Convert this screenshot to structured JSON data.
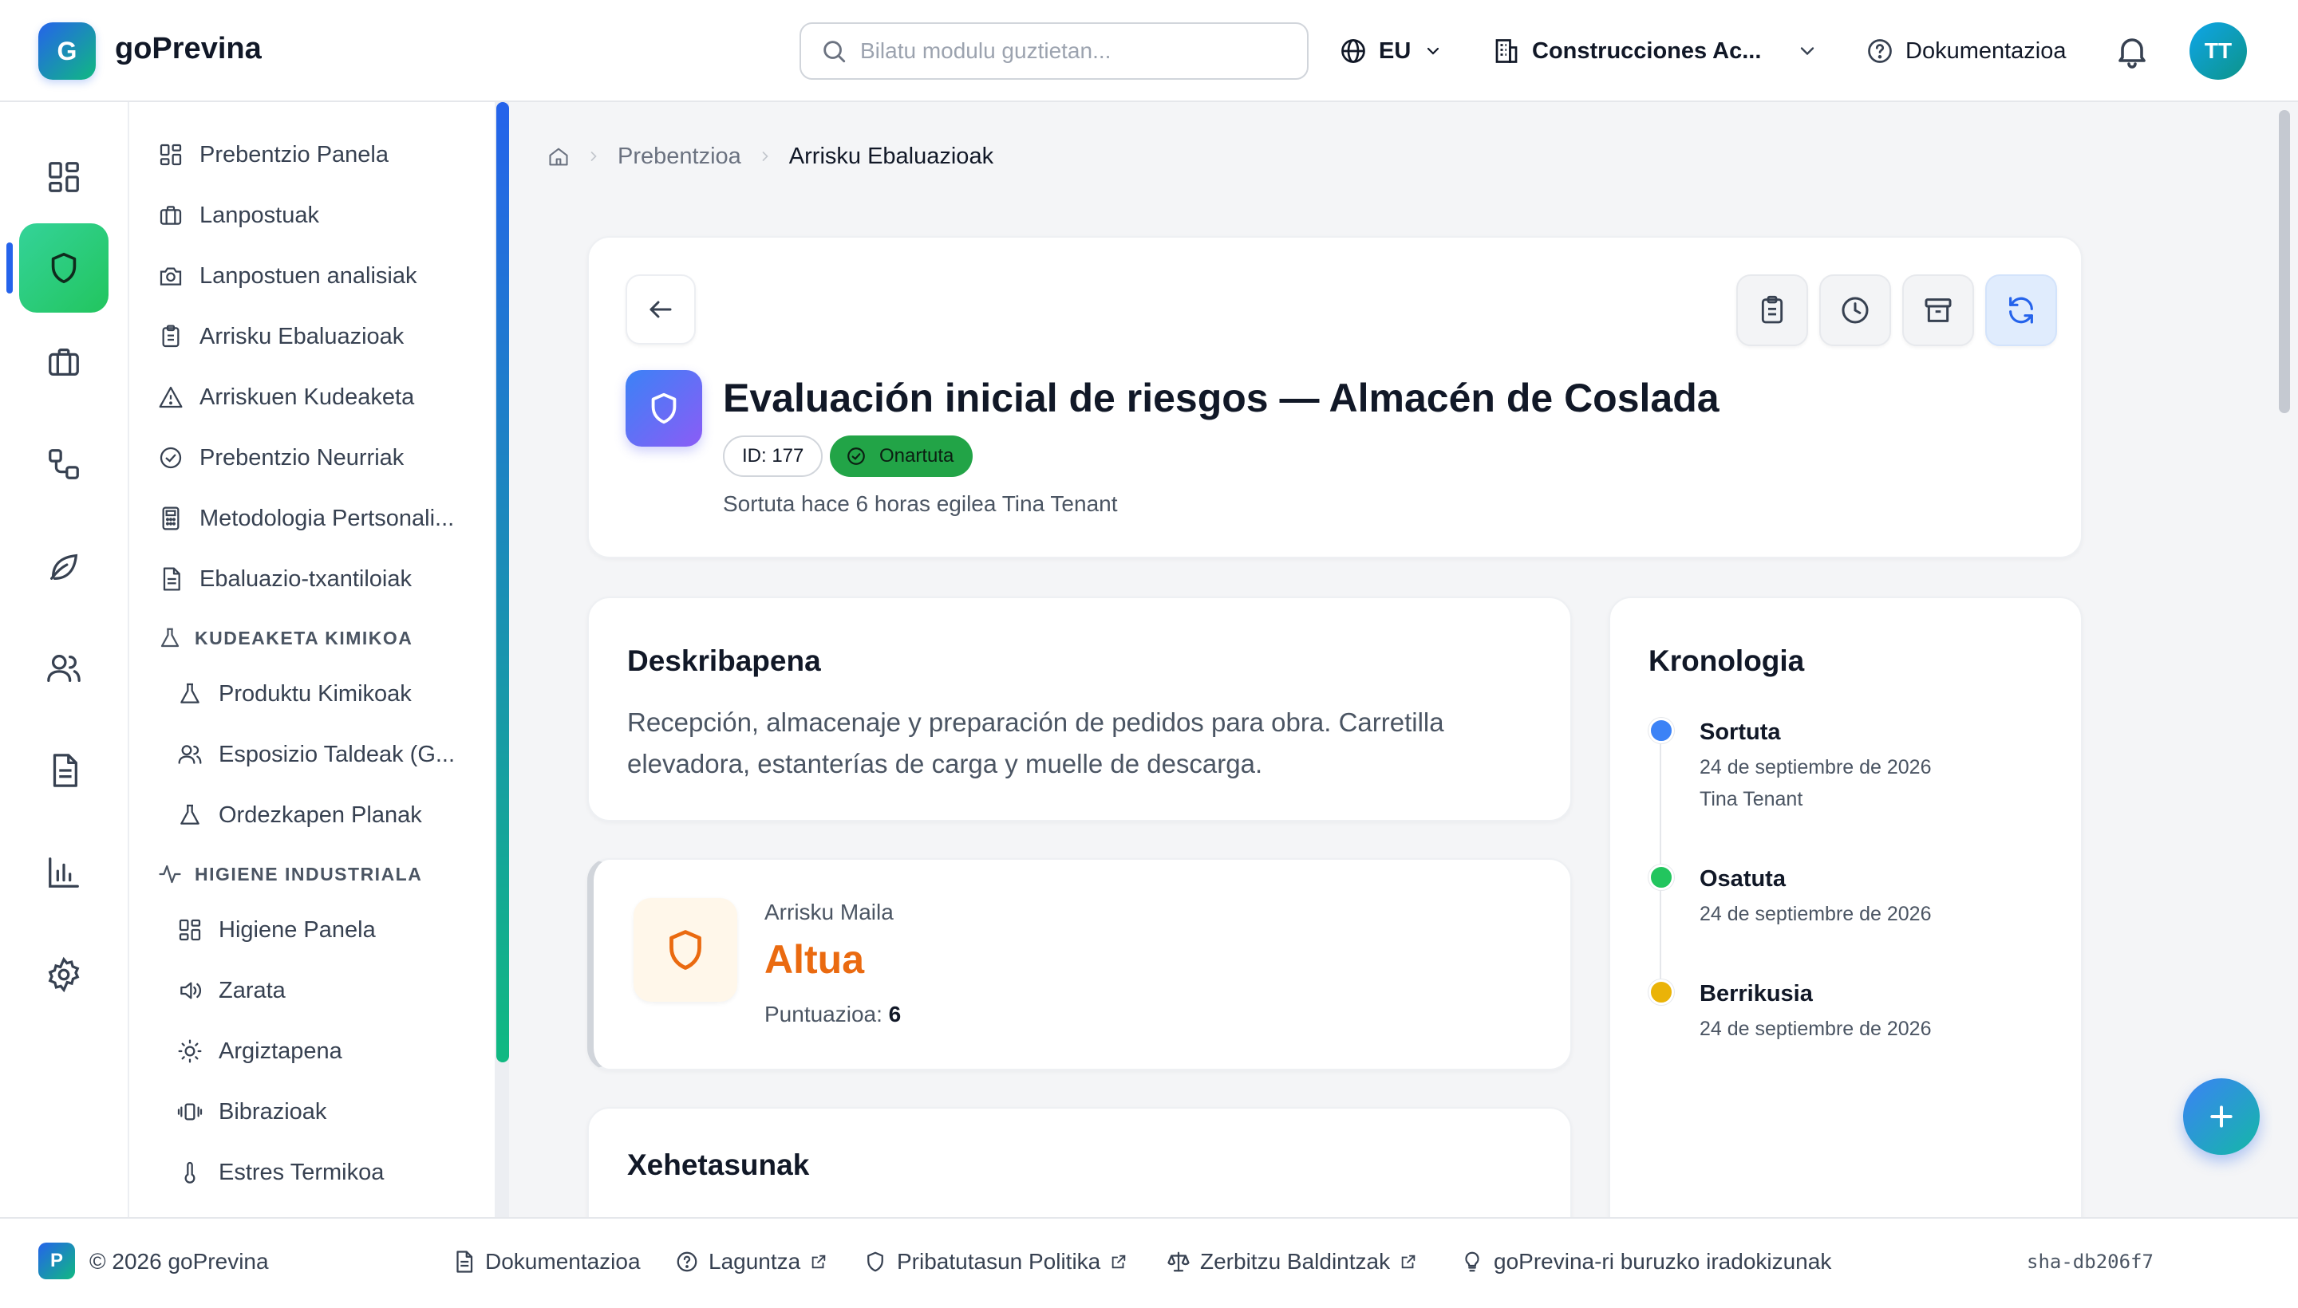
{
  "header": {
    "logo_letter": "G",
    "brand": "goPrevina",
    "search_placeholder": "Bilatu modulu guztietan...",
    "language": "EU",
    "company": "Construcciones Ac...",
    "docs_label": "Dokumentazioa",
    "avatar_initials": "TT"
  },
  "rail": {
    "items": [
      {
        "icon": "dashboard-icon",
        "active": false
      },
      {
        "icon": "shield-icon",
        "active": true
      },
      {
        "icon": "briefcase-icon",
        "active": false
      },
      {
        "icon": "workflow-icon",
        "active": false
      },
      {
        "icon": "leaf-icon",
        "active": false
      },
      {
        "icon": "users-icon",
        "active": false
      },
      {
        "icon": "document-icon",
        "active": false
      },
      {
        "icon": "bar-chart-icon",
        "active": false
      },
      {
        "icon": "gear-icon",
        "active": false
      }
    ]
  },
  "submenu": {
    "items": [
      {
        "label": "Prebentzio Panela",
        "icon": "dashboard-icon"
      },
      {
        "label": "Lanpostuak",
        "icon": "briefcase-icon"
      },
      {
        "label": "Lanpostuen analisiak",
        "icon": "camera-icon"
      },
      {
        "label": "Arrisku Ebaluazioak",
        "icon": "clipboard-icon"
      },
      {
        "label": "Arriskuen Kudeaketa",
        "icon": "warning-icon"
      },
      {
        "label": "Prebentzio Neurriak",
        "icon": "check-circle-icon"
      },
      {
        "label": "Metodologia Pertsonali...",
        "icon": "calculator-icon"
      },
      {
        "label": "Ebaluazio-txantiloiak",
        "icon": "file-text-icon"
      }
    ],
    "section_chemical": "KUDEAKETA KIMIKOA",
    "chemical_items": [
      {
        "label": "Produktu Kimikoak",
        "icon": "flask-icon"
      },
      {
        "label": "Esposizio Taldeak (G...",
        "icon": "users-icon"
      },
      {
        "label": "Ordezkapen Planak",
        "icon": "flask-icon"
      }
    ],
    "section_hygiene": "HIGIENE INDUSTRIALA",
    "hygiene_items": [
      {
        "label": "Higiene Panela",
        "icon": "dashboard-icon"
      },
      {
        "label": "Zarata",
        "icon": "speaker-icon"
      },
      {
        "label": "Argiztapena",
        "icon": "sun-icon"
      },
      {
        "label": "Bibrazioak",
        "icon": "vibration-icon"
      },
      {
        "label": "Estres Termikoa",
        "icon": "thermometer-icon"
      }
    ]
  },
  "breadcrumb": {
    "home_icon": "home-icon",
    "items": [
      "Prebentzioa",
      "Arrisku Ebaluazioak"
    ]
  },
  "evaluation": {
    "title": "Evaluación inicial de riesgos — Almacén de Coslada",
    "id_label": "ID: 177",
    "status": "Onartuta",
    "status_color": "#22a447",
    "created_text": "Sortuta hace 6 horas egilea Tina Tenant",
    "actions": [
      "clipboard-icon",
      "clock-icon",
      "archive-icon",
      "refresh-icon"
    ]
  },
  "description": {
    "heading": "Deskribapena",
    "text": "Recepción, almacenaje y preparación de pedidos para obra. Carretilla elevadora, estanterías de carga y muelle de descarga."
  },
  "risk": {
    "label": "Arrisku Maila",
    "value": "Altua",
    "value_color": "#ea6a10",
    "score_label": "Puntuazioa:",
    "score": "6"
  },
  "details": {
    "heading": "Xehetasunak"
  },
  "timeline": {
    "heading": "Kronologia",
    "events": [
      {
        "title": "Sortuta",
        "date": "24 de septiembre de 2026",
        "user": "Tina Tenant",
        "color": "#3b82f6"
      },
      {
        "title": "Osatuta",
        "date": "24 de septiembre de 2026",
        "user": "",
        "color": "#22c55e"
      },
      {
        "title": "Berrikusia",
        "date": "24 de septiembre de 2026",
        "user": "",
        "color": "#eab308"
      }
    ]
  },
  "footer": {
    "logo_letter": "P",
    "copyright": "© 2026 goPrevina",
    "links": [
      "Dokumentazioa",
      "Laguntza",
      "Pribatutasun Politika",
      "Zerbitzu Baldintzak",
      "goPrevina-ri buruzko iradokizunak"
    ],
    "sha": "sha-db206f7"
  }
}
